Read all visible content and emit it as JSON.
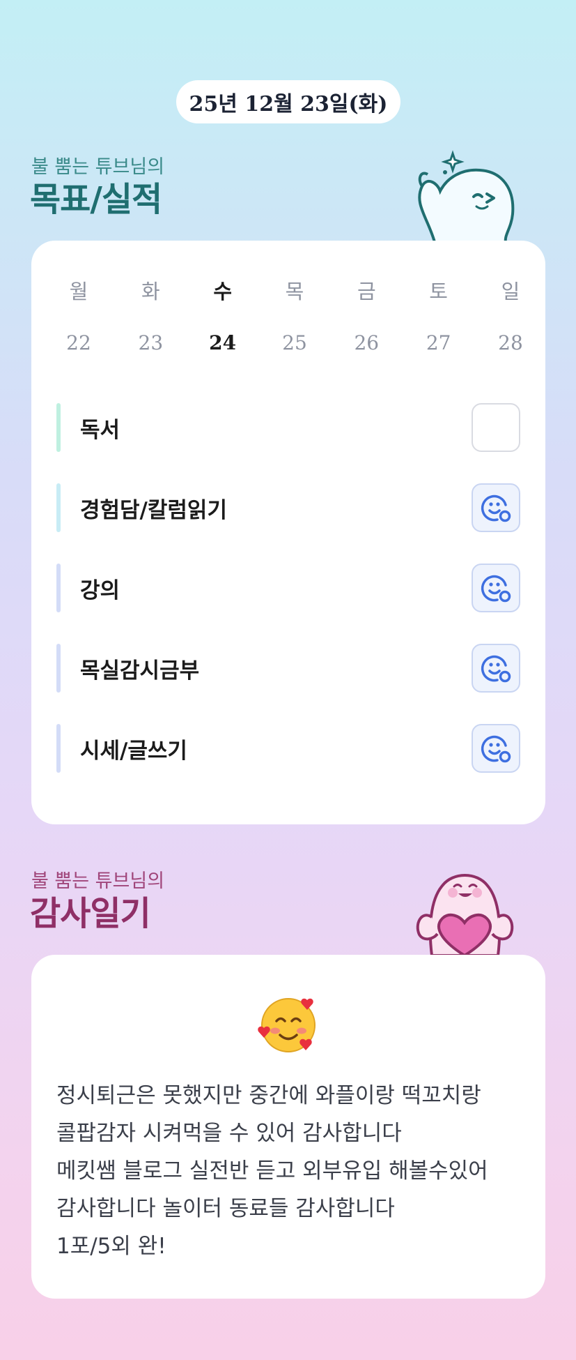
{
  "header": {
    "date": "25년 12월 23일(화)"
  },
  "goals_section": {
    "subtitle": "불 뿜는 튜브님의",
    "title": "목표/실적",
    "mascot": "ghost-thumbs-up-icon",
    "week": {
      "days": [
        "월",
        "화",
        "수",
        "목",
        "금",
        "토",
        "일"
      ],
      "dates": [
        "22",
        "23",
        "24",
        "25",
        "26",
        "27",
        "28"
      ],
      "selected_index": 2
    },
    "goals": [
      {
        "label": "독서",
        "done": false,
        "icon": "empty-checkbox",
        "bar_color": "#bff0e0"
      },
      {
        "label": "경험담/칼럼읽기",
        "done": true,
        "icon": "smile-check-icon",
        "bar_color": "#c8ecf5"
      },
      {
        "label": "강의",
        "done": true,
        "icon": "smile-check-icon",
        "bar_color": "#d3dcf7"
      },
      {
        "label": "목실감시금부",
        "done": true,
        "icon": "smile-check-icon",
        "bar_color": "#d3dcf7"
      },
      {
        "label": "시세/글쓰기",
        "done": true,
        "icon": "smile-check-icon",
        "bar_color": "#d3dcf7"
      }
    ]
  },
  "diary_section": {
    "subtitle": "불 뿜는 튜브님의",
    "title": "감사일기",
    "mascot": "ghost-holding-heart-icon",
    "emoji": "smiling-face-with-hearts-icon",
    "lines": [
      "정시퇴근은 못했지만 중간에 와플이랑 떡꼬치랑",
      "콜팝감자 시켜먹을 수 있어 감사합니다",
      "메킷쌤 블로그 실전반 듣고 외부유입 해볼수있어",
      "감사합니다 놀이터 동료들 감사합니다",
      "1포/5외 완!"
    ]
  },
  "colors": {
    "accent_blue": "#3e6fe0",
    "teal_title": "#1f6e70",
    "pink_title": "#8f2f66"
  }
}
